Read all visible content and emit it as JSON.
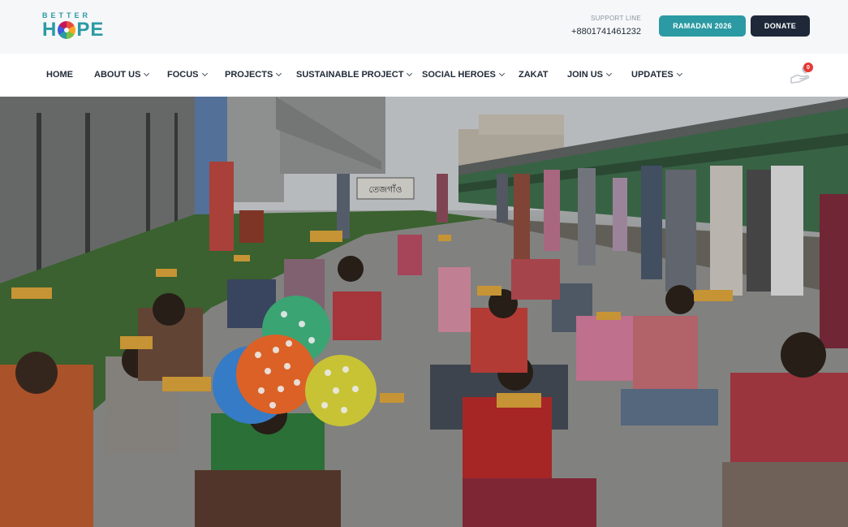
{
  "logo": {
    "top": "BETTER",
    "bottom_left": "H",
    "bottom_right": "PE"
  },
  "support": {
    "label": "SUPPORT LINE",
    "phone": "+8801741461232"
  },
  "buttons": {
    "ramadan": "RAMADAN 2026",
    "donate": "DONATE"
  },
  "nav": {
    "items": [
      {
        "label": "HOME",
        "dropdown": false
      },
      {
        "label": "ABOUT US",
        "dropdown": true
      },
      {
        "label": "FOCUS",
        "dropdown": true
      },
      {
        "label": "PROJECTS",
        "dropdown": true
      },
      {
        "label": "SUSTAINABLE PROJECT",
        "dropdown": true
      },
      {
        "label": "SOCIAL HEROES",
        "dropdown": true
      },
      {
        "label": "ZAKAT",
        "dropdown": false
      },
      {
        "label": "JOIN US",
        "dropdown": true
      },
      {
        "label": "UPDATES",
        "dropdown": true
      }
    ],
    "cart_count": "0"
  },
  "hero": {
    "station_sign": "তেজগাঁও"
  },
  "colors": {
    "accent": "#2b9aa3",
    "dark": "#1e2838",
    "badge": "#e53935"
  }
}
